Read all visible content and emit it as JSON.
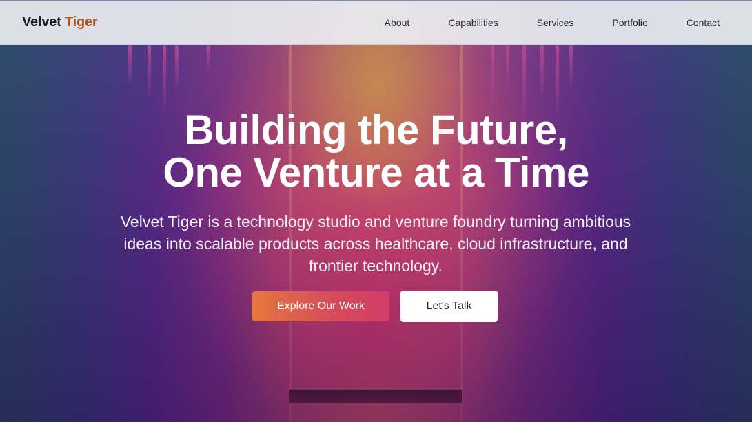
{
  "nav": {
    "logo_primary": "Velvet",
    "logo_accent": "Tiger",
    "links": [
      "About",
      "Capabilities",
      "Services",
      "Portfolio",
      "Contact"
    ]
  },
  "hero": {
    "headline_line1": "Building the Future,",
    "headline_line2": "One Venture at a Time",
    "subtext": "Velvet Tiger is a technology studio and venture foundry turning ambitious ideas into scalable products across healthcare, cloud infrastructure, and frontier technology.",
    "primary_button": "Explore Our Work",
    "secondary_button": "Let's Talk"
  },
  "colors": {
    "logo_accent": "#b3521e",
    "primary_button_start": "#e5783e",
    "primary_button_end": "#d23d6a",
    "nav_background": "#e8ecf0"
  }
}
